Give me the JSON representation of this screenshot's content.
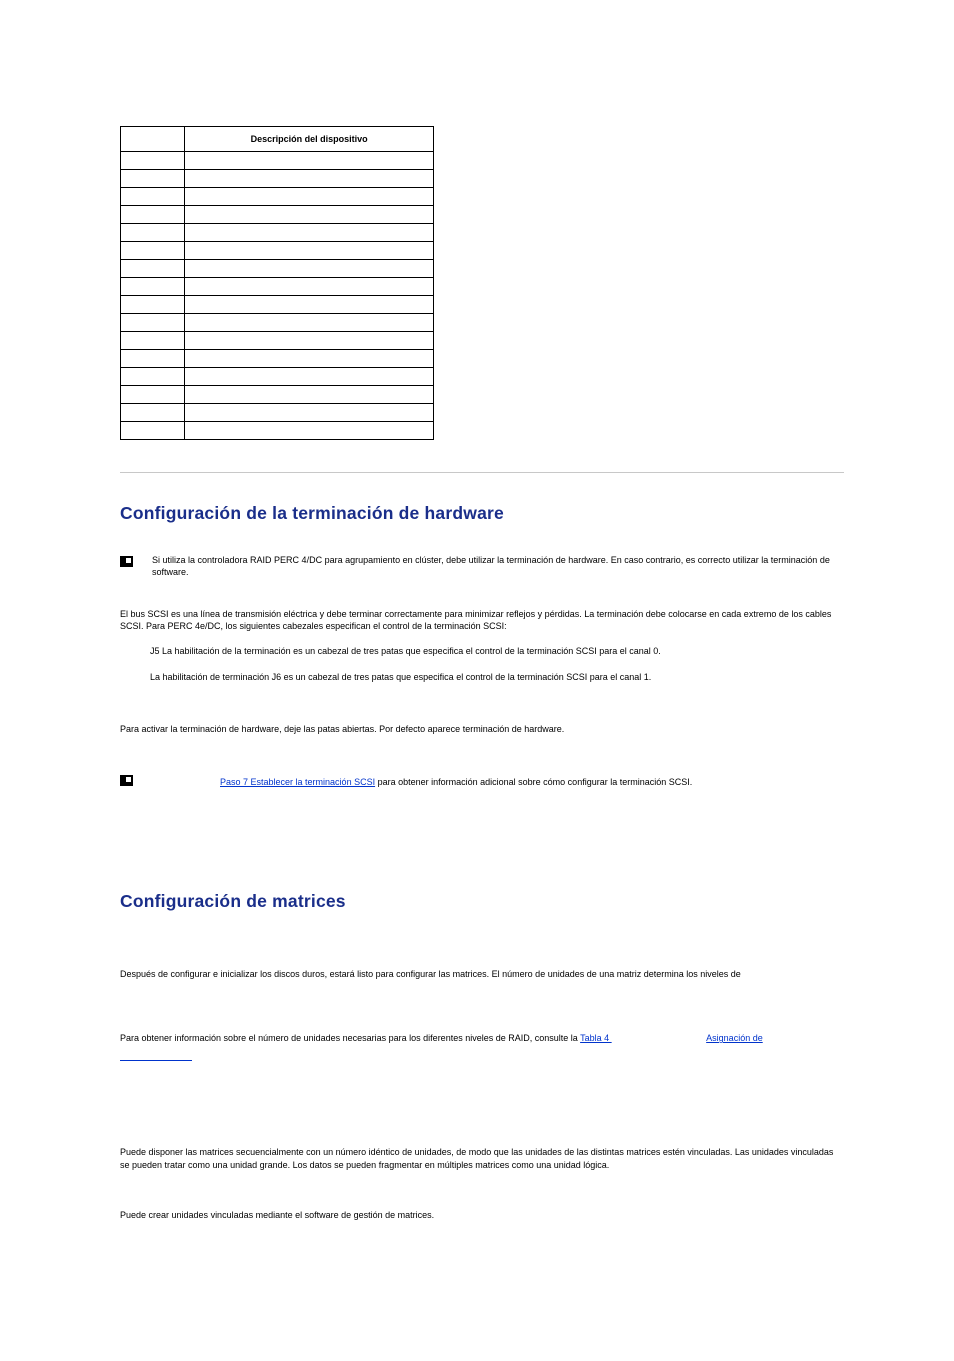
{
  "table": {
    "col_id_header": "",
    "col_desc_header": "Descripción del dispositivo",
    "row_count": 16
  },
  "section1": {
    "title": "Configuración de la terminación de hardware",
    "note1": "Si utiliza la controladora RAID PERC 4/DC para agrupamiento en clúster, debe utilizar la terminación de hardware. En caso contrario, es correcto utilizar la terminación de software.",
    "p1": "El bus SCSI es una línea de transmisión eléctrica y debe terminar correctamente para minimizar reflejos y pérdidas. La terminación debe colocarse en cada extremo de los cables SCSI. Para PERC 4e/DC, los siguientes cabezales especifican el control de la terminación SCSI:",
    "li1": "J5 La habilitación de la terminación es un cabezal de tres patas que especifica el control de la terminación SCSI para el canal 0.",
    "li2": "La habilitación de terminación J6 es un cabezal de tres patas que especifica el control de la terminación SCSI para el canal 1.",
    "p2": "Para activar la terminación de hardware, deje las patas abiertas. Por defecto aparece terminación de hardware.",
    "note2_link": "Paso 7 Establecer la terminación SCSI",
    "note2_after": " para obtener información adicional sobre cómo configurar la terminación SCSI."
  },
  "section2": {
    "title": "Configuración de matrices",
    "p1": "Después de configurar e inicializar los discos duros, estará listo para configurar las matrices. El número de unidades de una matriz determina los niveles de",
    "p2_before": "Para obtener información sobre el número de unidades necesarias para los diferentes niveles de RAID, consulte la ",
    "p2_link1": "Tabla 4    ",
    "p2_between": "                                      ",
    "p2_link2": "Asignación de",
    "p3": "Puede disponer las matrices secuencialmente con un número idéntico de unidades, de modo que las unidades de las distintas matrices estén vinculadas. Las unidades vinculadas se pueden tratar como una unidad grande. Los datos se pueden fragmentar en múltiples matrices como una unidad lógica.",
    "p4": "Puede crear unidades vinculadas mediante el software de gestión de matrices."
  }
}
